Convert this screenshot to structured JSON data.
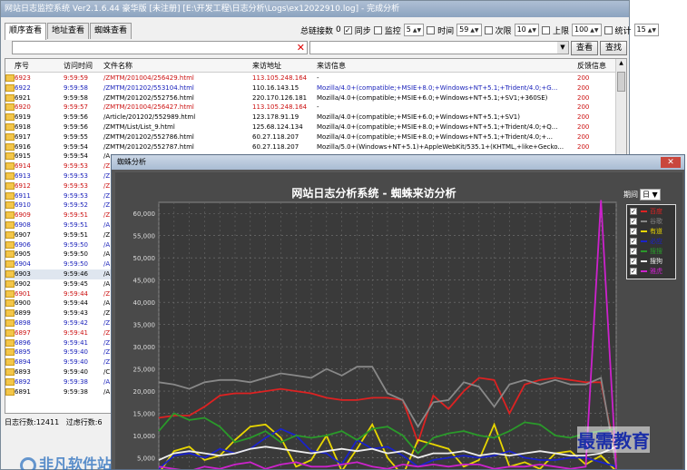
{
  "window": {
    "title": "网站日志监控系统 Ver2.1.6.44 豪华版  [未注册]  [E:\\开发工程\\日志分析\\Logs\\ex12022910.log] - 完成分析"
  },
  "tabs": [
    "顺序查看",
    "地址查看",
    "蜘蛛查看"
  ],
  "toolbar": {
    "total_label": "总链接数",
    "total_value": "0",
    "sync_label": "同步",
    "monitor_label": "监控",
    "monitor_value": "5",
    "interval_label": "时间",
    "interval_value": "59",
    "count_label": "次限",
    "count_value": "10",
    "upper_label": "上限",
    "upper_value": "100",
    "stats_label": "统计",
    "stats_value": "15"
  },
  "filter": {
    "clear_glyph": "✕",
    "view_button": "查看",
    "search_button": "查找"
  },
  "table": {
    "headers": [
      "序号",
      "访问时间",
      "文件名称",
      "来访地址",
      "来访信息",
      "反馈信息"
    ],
    "rows": [
      {
        "id": "6923",
        "time": "9:59:59",
        "file": "/ZMTM/201004/256429.html",
        "ip": "113.105.248.164",
        "info": "-",
        "status": "200",
        "color": "red"
      },
      {
        "id": "6922",
        "time": "9:59:58",
        "file": "/ZMTM/201202/553104.html",
        "ip": "110.16.143.15",
        "info": "Mozilla/4.0+(compatible;+MSIE+8.0;+Windows+NT+5.1;+Trident/4.0;+G...",
        "status": "200",
        "color": "blue"
      },
      {
        "id": "6921",
        "time": "9:59:58",
        "file": "/ZMTM/201202/552756.html",
        "ip": "220.170.126.181",
        "info": "Mozilla/4.0+(compatible;+MSIE+6.0;+Windows+NT+5.1;+SV1;+360SE)",
        "status": "200",
        "color": "black"
      },
      {
        "id": "6920",
        "time": "9:59:57",
        "file": "/ZMTM/201004/256427.html",
        "ip": "113.105.248.164",
        "info": "-",
        "status": "200",
        "color": "red"
      },
      {
        "id": "6919",
        "time": "9:59:56",
        "file": "/Article/201202/552989.html",
        "ip": "123.178.91.19",
        "info": "Mozilla/4.0+(compatible;+MSIE+6.0;+Windows+NT+5.1;+SV1)",
        "status": "200",
        "color": "black"
      },
      {
        "id": "6918",
        "time": "9:59:56",
        "file": "/ZMTM/List/List_9.html",
        "ip": "125.68.124.134",
        "info": "Mozilla/4.0+(compatible;+MSIE+8.0;+Windows+NT+5.1;+Trident/4.0;+Q...",
        "status": "200",
        "color": "black"
      },
      {
        "id": "6917",
        "time": "9:59:55",
        "file": "/ZMTM/201202/552786.html",
        "ip": "60.27.118.207",
        "info": "Mozilla/4.0+(compatible;+MSIE+8.0;+Windows+NT+5.1;+Trident/4.0;+...",
        "status": "200",
        "color": "black"
      },
      {
        "id": "6916",
        "time": "9:59:54",
        "file": "/ZMTM/201202/552787.html",
        "ip": "60.27.118.207",
        "info": "Mozilla/5.0+(Windows+NT+5.1)+AppleWebKit/535.1+(KHTML,+like+Gecko...",
        "status": "200",
        "color": "black"
      },
      {
        "id": "6915",
        "time": "9:59:54",
        "file": "/A",
        "ip": "",
        "info": "",
        "status": "",
        "color": "black"
      },
      {
        "id": "6914",
        "time": "9:59:53",
        "file": "/Z",
        "ip": "",
        "info": "",
        "status": "",
        "color": "red"
      },
      {
        "id": "6913",
        "time": "9:59:53",
        "file": "/Z",
        "ip": "",
        "info": "",
        "status": "",
        "color": "blue"
      },
      {
        "id": "6912",
        "time": "9:59:53",
        "file": "/Z",
        "ip": "",
        "info": "",
        "status": "",
        "color": "red"
      },
      {
        "id": "6911",
        "time": "9:59:53",
        "file": "/Z",
        "ip": "",
        "info": "",
        "status": "",
        "color": "blue"
      },
      {
        "id": "6910",
        "time": "9:59:52",
        "file": "/Z",
        "ip": "",
        "info": "",
        "status": "",
        "color": "blue"
      },
      {
        "id": "6909",
        "time": "9:59:51",
        "file": "/Z",
        "ip": "",
        "info": "",
        "status": "",
        "color": "red"
      },
      {
        "id": "6908",
        "time": "9:59:51",
        "file": "/A",
        "ip": "",
        "info": "",
        "status": "",
        "color": "blue"
      },
      {
        "id": "6907",
        "time": "9:59:51",
        "file": "/Z",
        "ip": "",
        "info": "",
        "status": "",
        "color": "black"
      },
      {
        "id": "6906",
        "time": "9:59:50",
        "file": "/A",
        "ip": "",
        "info": "",
        "status": "",
        "color": "blue"
      },
      {
        "id": "6905",
        "time": "9:59:50",
        "file": "/A",
        "ip": "",
        "info": "",
        "status": "",
        "color": "black"
      },
      {
        "id": "6904",
        "time": "9:59:50",
        "file": "/A",
        "ip": "",
        "info": "",
        "status": "",
        "color": "blue"
      },
      {
        "id": "6903",
        "time": "9:59:46",
        "file": "/A",
        "ip": "",
        "info": "",
        "status": "",
        "color": "black",
        "selected": true
      },
      {
        "id": "6902",
        "time": "9:59:45",
        "file": "/A",
        "ip": "",
        "info": "",
        "status": "",
        "color": "black"
      },
      {
        "id": "6901",
        "time": "9:59:44",
        "file": "/Z",
        "ip": "",
        "info": "",
        "status": "",
        "color": "red"
      },
      {
        "id": "6900",
        "time": "9:59:44",
        "file": "/A",
        "ip": "",
        "info": "",
        "status": "",
        "color": "black"
      },
      {
        "id": "6899",
        "time": "9:59:43",
        "file": "/Z",
        "ip": "",
        "info": "",
        "status": "",
        "color": "black"
      },
      {
        "id": "6898",
        "time": "9:59:42",
        "file": "/Z",
        "ip": "",
        "info": "",
        "status": "",
        "color": "blue"
      },
      {
        "id": "6897",
        "time": "9:59:41",
        "file": "/Z",
        "ip": "",
        "info": "",
        "status": "",
        "color": "red"
      },
      {
        "id": "6896",
        "time": "9:59:41",
        "file": "/Z",
        "ip": "",
        "info": "",
        "status": "",
        "color": "blue"
      },
      {
        "id": "6895",
        "time": "9:59:40",
        "file": "/Z",
        "ip": "",
        "info": "",
        "status": "",
        "color": "blue"
      },
      {
        "id": "6894",
        "time": "9:59:40",
        "file": "/Z",
        "ip": "",
        "info": "",
        "status": "",
        "color": "blue"
      },
      {
        "id": "6893",
        "time": "9:59:40",
        "file": "/C",
        "ip": "",
        "info": "",
        "status": "",
        "color": "black"
      },
      {
        "id": "6892",
        "time": "9:59:38",
        "file": "/A",
        "ip": "",
        "info": "",
        "status": "",
        "color": "blue"
      },
      {
        "id": "6891",
        "time": "9:59:38",
        "file": "/A",
        "ip": "",
        "info": "",
        "status": "",
        "color": "black"
      }
    ]
  },
  "status": {
    "lines_label": "日志行数:",
    "lines_value": "12411",
    "filter_label": "过虑行数:",
    "filter_value": "6"
  },
  "colors": {
    "red": "#cc1111",
    "blue": "#1a22bb",
    "black": "#000000"
  },
  "dialog": {
    "title": "蜘蛛分析",
    "close_glyph": "✕",
    "period_label": "期间",
    "period_value": "日"
  },
  "chart_data": {
    "type": "line",
    "title": "网站日志分析系统 - 蜘蛛来访分析",
    "ylim": [
      0,
      62500
    ],
    "y_ticks": [
      "5,000",
      "10,000",
      "15,000",
      "20,000",
      "25,000",
      "30,000",
      "35,000",
      "40,000",
      "45,000",
      "50,000",
      "55,000",
      "60,000"
    ],
    "grid": true,
    "legend_position": "right",
    "series": [
      {
        "name": "百度",
        "color": "#dd2222",
        "values": [
          14000,
          14500,
          14500,
          16500,
          19000,
          19500,
          19500,
          20000,
          20500,
          20000,
          19500,
          18500,
          18000,
          18000,
          18500,
          18500,
          18000,
          8500,
          19000,
          16000,
          20000,
          23000,
          22500,
          15000,
          21500,
          22500,
          23000,
          22500,
          22000,
          22000,
          5000
        ]
      },
      {
        "name": "谷歌",
        "color": "#888888",
        "values": [
          22000,
          21500,
          20500,
          22000,
          22500,
          22500,
          22000,
          23000,
          24000,
          23500,
          23000,
          25000,
          23500,
          25500,
          25500,
          19500,
          18000,
          12000,
          17500,
          18000,
          22000,
          21000,
          16500,
          21500,
          22500,
          21500,
          22500,
          21500,
          21500,
          23000,
          3000
        ]
      },
      {
        "name": "有道",
        "color": "#e8d600",
        "values": [
          1500,
          6500,
          7500,
          4500,
          5500,
          9000,
          12000,
          12500,
          9500,
          3000,
          4500,
          10000,
          2000,
          7000,
          12500,
          5000,
          1000,
          9000,
          8000,
          7000,
          3000,
          4500,
          12500,
          3000,
          4000,
          2500,
          6000,
          6500,
          3500,
          5500,
          2000
        ]
      },
      {
        "name": "必应",
        "color": "#1a22cc",
        "values": [
          2500,
          5500,
          6000,
          5000,
          7000,
          6000,
          7000,
          9500,
          11500,
          10000,
          6500,
          6000,
          3500,
          9000,
          7000,
          7500,
          5500,
          3000,
          4500,
          5000,
          5500,
          5000,
          5500,
          6500,
          5000,
          4500,
          4500,
          5000,
          5000,
          4000,
          3000
        ]
      },
      {
        "name": "搜搜",
        "color": "#2a9a2a",
        "values": [
          11000,
          15000,
          13500,
          14000,
          12000,
          8500,
          9500,
          11000,
          8500,
          10000,
          9500,
          10000,
          11000,
          9000,
          11500,
          12000,
          10000,
          6000,
          9500,
          10500,
          11000,
          10000,
          9500,
          11000,
          13000,
          12500,
          10000,
          9500,
          10500,
          11000,
          11500
        ]
      },
      {
        "name": "搜狗",
        "color": "#eeeeee",
        "values": [
          4500,
          6000,
          6500,
          6000,
          5500,
          6000,
          7000,
          7500,
          7000,
          6500,
          6000,
          6500,
          7000,
          6500,
          7000,
          6000,
          6500,
          5000,
          6000,
          6000,
          6500,
          5500,
          6000,
          5500,
          6000,
          6500,
          6000,
          5500,
          5500,
          6000,
          7500
        ]
      },
      {
        "name": "雅虎",
        "color": "#cc22cc",
        "values": [
          3000,
          2500,
          2000,
          3000,
          2500,
          3500,
          4000,
          2500,
          3500,
          4000,
          3000,
          3000,
          3500,
          4000,
          3000,
          2500,
          3500,
          3000,
          3500,
          3000,
          3500,
          3500,
          2500,
          3000,
          3000,
          3500,
          3000,
          2500,
          3000,
          63000,
          2500
        ]
      }
    ]
  },
  "watermark": {
    "right": "最需教育",
    "left": "非凡软件站"
  }
}
